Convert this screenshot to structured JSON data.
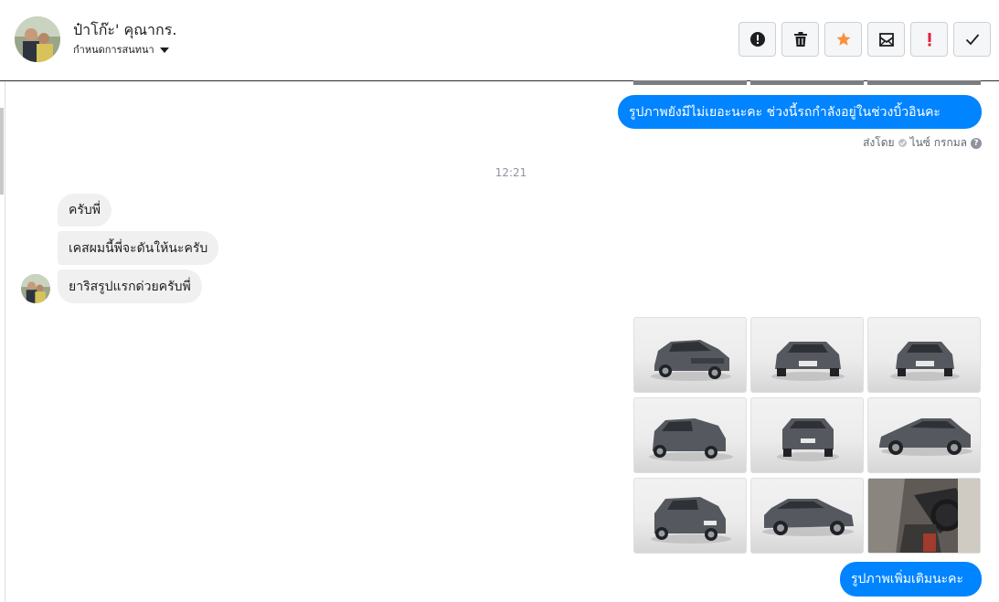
{
  "header": {
    "contact_name": "ป๋าโก๊ะ' คุณากร.",
    "label_dropdown": "กำหนดการสนทนา",
    "actions": [
      {
        "name": "report-button",
        "icon": "exclamation-octagon-icon"
      },
      {
        "name": "delete-button",
        "icon": "trash-icon"
      },
      {
        "name": "star-button",
        "icon": "star-icon",
        "color": "#f7923a"
      },
      {
        "name": "unread-button",
        "icon": "envelope-icon"
      },
      {
        "name": "priority-button",
        "icon": "exclamation-icon",
        "color": "#e41e3f"
      },
      {
        "name": "done-button",
        "icon": "checkmark-icon"
      }
    ]
  },
  "messages": {
    "outgoing_1": "รูปภาพยังมีไม่เยอะนะคะ  ช่วงนี้รถกำลังอยู่ในช่วงบิ้วอินคะ",
    "sent_by_label": "ส่งโดย",
    "sent_by_name": "ไนซ์ กรกมล",
    "timestamp": "12:21",
    "incoming_1": "ครับพี่",
    "incoming_2": "เคสผมนี้พี่จะดันให้นะครับ",
    "incoming_3": "ยาริสรูปแรกด่วยครับพี่",
    "outgoing_2": "รูปภาพเพิ่มเติมนะคะ"
  },
  "photos": [
    {
      "view": "front-left"
    },
    {
      "view": "front"
    },
    {
      "view": "front-right"
    },
    {
      "view": "rear-left"
    },
    {
      "view": "rear"
    },
    {
      "view": "side-left"
    },
    {
      "view": "rear-left-angle"
    },
    {
      "view": "side-right"
    },
    {
      "view": "interior"
    }
  ],
  "colors": {
    "accent": "#0084ff",
    "incoming_bubble": "#f1f0f0",
    "car_body": "#55595f"
  }
}
